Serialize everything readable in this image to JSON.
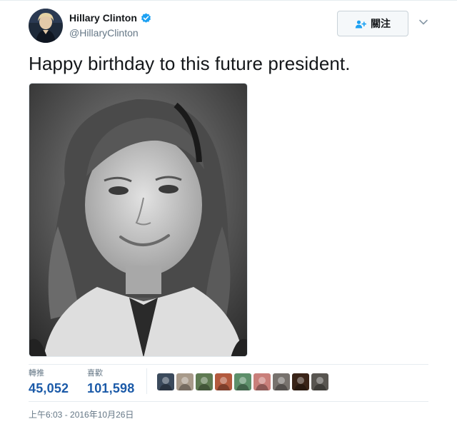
{
  "author": {
    "name": "Hillary Clinton",
    "handle": "@HillaryClinton",
    "verified": true
  },
  "follow_button": {
    "label": "關注",
    "icon": "person-plus-icon"
  },
  "tweet": {
    "text": "Happy birthday to this future president.",
    "photo_alt": "black-and-white childhood portrait"
  },
  "stats": {
    "retweets": {
      "label": "轉推",
      "value": "45,052"
    },
    "likes": {
      "label": "喜歡",
      "value": "101,598"
    }
  },
  "liker_avatars": [
    {
      "name": "liker-1",
      "color": "#3b4a5c"
    },
    {
      "name": "liker-2",
      "color": "#a89a8a"
    },
    {
      "name": "liker-3",
      "color": "#5f7a52"
    },
    {
      "name": "liker-4",
      "color": "#b35a3e"
    },
    {
      "name": "liker-5",
      "color": "#5d8f6a"
    },
    {
      "name": "liker-6",
      "color": "#c97f7a"
    },
    {
      "name": "liker-7",
      "color": "#77726d"
    },
    {
      "name": "liker-8",
      "color": "#3a2418"
    },
    {
      "name": "liker-9",
      "color": "#585550"
    }
  ],
  "timestamp": "上午6:03 - 2016年10月26日",
  "colors": {
    "link_blue": "#1b5aa8",
    "verified_blue": "#1da1f2",
    "muted": "#657786"
  }
}
